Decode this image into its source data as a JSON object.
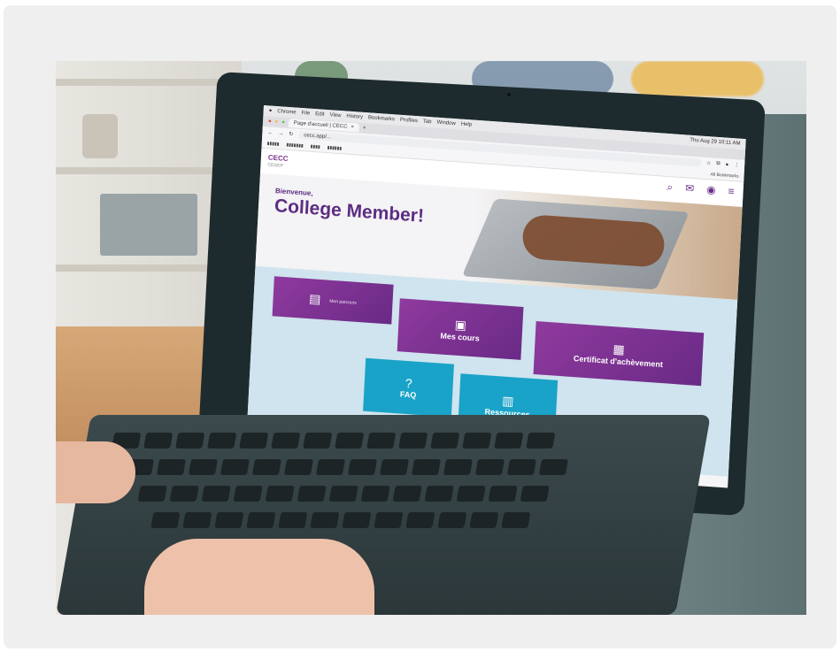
{
  "browser": {
    "menu_items": [
      "Chrome",
      "File",
      "Edit",
      "View",
      "History",
      "Bookmarks",
      "Profiles",
      "Tab",
      "Window",
      "Help"
    ],
    "clock": "Thu Aug 29 10:11 AM",
    "tab_title": "Page d'accueil | CECC",
    "url": "cecc.app/...",
    "bookmarks": [
      "All Bookmarks"
    ]
  },
  "site": {
    "logo_line1": "CECC",
    "logo_line2": "CEGEP",
    "welcome": "Bienvenue,",
    "member": "College Member!",
    "header_icons": [
      "search-icon",
      "mail-icon",
      "account-icon",
      "menu-icon"
    ]
  },
  "tiles": [
    {
      "key": "tile1",
      "title": "",
      "desc": "Mon parcours",
      "color": "#7a2e8c",
      "icon": "book-icon"
    },
    {
      "key": "mes_cours",
      "title": "Mes cours",
      "desc": "",
      "color": "#7a2e8c",
      "icon": "course-icon"
    },
    {
      "key": "certificat",
      "title": "Certificat d'achèvement",
      "desc": "",
      "color": "#7a2e8c",
      "icon": "certificate-icon"
    },
    {
      "key": "faq",
      "title": "FAQ",
      "desc": "",
      "color": "#1aa3c8",
      "icon": "question-icon"
    },
    {
      "key": "ressources",
      "title": "Ressources",
      "desc": "",
      "color": "#1aa3c8",
      "icon": "document-icon"
    }
  ]
}
